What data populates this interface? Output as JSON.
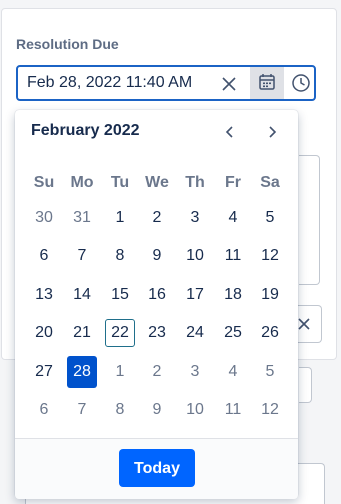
{
  "field": {
    "label": "Resolution Due",
    "value": "Feb 28, 2022 11:40 AM"
  },
  "calendar": {
    "month_title": "February 2022",
    "weekdays": [
      "Su",
      "Mo",
      "Tu",
      "We",
      "Th",
      "Fr",
      "Sa"
    ],
    "weeks": [
      [
        {
          "d": "30",
          "m": true
        },
        {
          "d": "31",
          "m": true
        },
        {
          "d": "1"
        },
        {
          "d": "2"
        },
        {
          "d": "3"
        },
        {
          "d": "4"
        },
        {
          "d": "5"
        }
      ],
      [
        {
          "d": "6"
        },
        {
          "d": "7"
        },
        {
          "d": "8"
        },
        {
          "d": "9"
        },
        {
          "d": "10"
        },
        {
          "d": "11"
        },
        {
          "d": "12"
        }
      ],
      [
        {
          "d": "13"
        },
        {
          "d": "14"
        },
        {
          "d": "15"
        },
        {
          "d": "16"
        },
        {
          "d": "17"
        },
        {
          "d": "18"
        },
        {
          "d": "19"
        }
      ],
      [
        {
          "d": "20"
        },
        {
          "d": "21"
        },
        {
          "d": "22",
          "today": true
        },
        {
          "d": "23"
        },
        {
          "d": "24"
        },
        {
          "d": "25"
        },
        {
          "d": "26"
        }
      ],
      [
        {
          "d": "27"
        },
        {
          "d": "28",
          "selected": true
        },
        {
          "d": "1",
          "m": true
        },
        {
          "d": "2",
          "m": true
        },
        {
          "d": "3",
          "m": true
        },
        {
          "d": "4",
          "m": true
        },
        {
          "d": "5",
          "m": true
        }
      ],
      [
        {
          "d": "6",
          "m": true
        },
        {
          "d": "7",
          "m": true
        },
        {
          "d": "8",
          "m": true
        },
        {
          "d": "9",
          "m": true
        },
        {
          "d": "10",
          "m": true
        },
        {
          "d": "11",
          "m": true
        },
        {
          "d": "12",
          "m": true
        }
      ]
    ],
    "today_button": "Today"
  },
  "icons": {
    "clear": "close-icon",
    "calendar": "calendar-icon",
    "clock": "clock-icon",
    "prev": "chevron-left-icon",
    "next": "chevron-right-icon"
  },
  "colors": {
    "accent": "#0052cc",
    "button": "#0065ff",
    "input_border": "#1b63c5",
    "today_outline": "#1f6f8b"
  }
}
